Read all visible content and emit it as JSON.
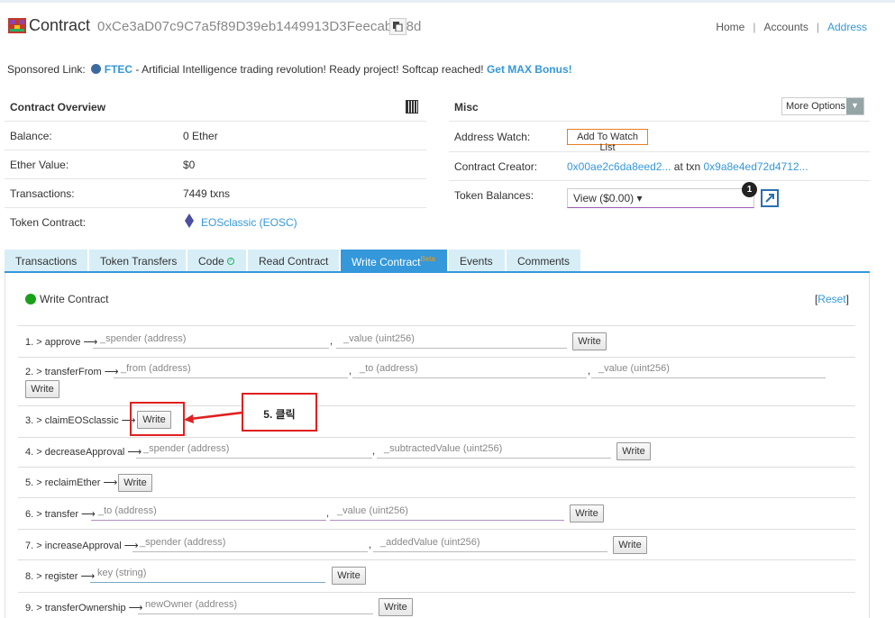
{
  "header": {
    "title": "Contract",
    "address": "0xCe3aD07c9C7a5f89D39eb1449913D3FeecabCf8d",
    "breadcrumbs": [
      "Home",
      "Accounts",
      "Address"
    ]
  },
  "sponsor": {
    "prefix": "Sponsored Link:",
    "brand": "FTEC",
    "text": " - Artificial Intelligence trading revolution! Ready project! Softcap reached!",
    "cta": "Get MAX Bonus!"
  },
  "overview": {
    "title": "Contract Overview",
    "rows": [
      {
        "label": "Balance:",
        "value": "0 Ether"
      },
      {
        "label": "Ether Value:",
        "value": "$0"
      },
      {
        "label": "Transactions:",
        "value": "7449 txns"
      },
      {
        "label": "Token Contract:",
        "value": "EOSclassic (EOSC)"
      }
    ]
  },
  "misc": {
    "title": "Misc",
    "more_options": "More Options",
    "address_watch_label": "Address Watch:",
    "watch_button": "Add To Watch List",
    "creator_label": "Contract Creator:",
    "creator_addr": "0x00ae2c6da8eed2...",
    "at_txn": "at txn",
    "creator_txn": "0x9a8e4ed72d4712...",
    "token_balances_label": "Token Balances:",
    "token_view": "View ($0.00) ▾",
    "badge_count": "1"
  },
  "tabs": [
    {
      "label": "Transactions"
    },
    {
      "label": "Token Transfers"
    },
    {
      "label": "Code"
    },
    {
      "label": "Read Contract"
    },
    {
      "label": "Write Contract",
      "sup": "Beta"
    },
    {
      "label": "Events"
    },
    {
      "label": "Comments"
    }
  ],
  "write": {
    "heading": "Write Contract",
    "reset": "Reset",
    "button_label": "Write",
    "functions": [
      {
        "label": "1. > approve ⟶",
        "inputs": [
          "_spender (address)",
          "_value (uint256)"
        ]
      },
      {
        "label": "2. > transferFrom ⟶",
        "inputs": [
          "_from (address)",
          "_to (address)",
          "_value (uint256)"
        ]
      },
      {
        "label": "3. > claimEOSclassic ⟶",
        "inputs": []
      },
      {
        "label": "4. > decreaseApproval ⟶",
        "inputs": [
          "_spender (address)",
          "_subtractedValue (uint256)"
        ]
      },
      {
        "label": "5. > reclaimEther ⟶",
        "inputs": []
      },
      {
        "label": "6. > transfer ⟶",
        "inputs": [
          "_to (address)",
          "_value (uint256)"
        ]
      },
      {
        "label": "7. > increaseApproval ⟶",
        "inputs": [
          "_spender (address)",
          "_addedValue (uint256)"
        ]
      },
      {
        "label": "8. > register ⟶",
        "inputs": [
          "key (string)"
        ]
      },
      {
        "label": "9. > transferOwnership ⟶",
        "inputs": [
          "newOwner (address)"
        ]
      }
    ]
  },
  "annotation": {
    "text": "5. 클릭",
    "color": "#e02020"
  }
}
